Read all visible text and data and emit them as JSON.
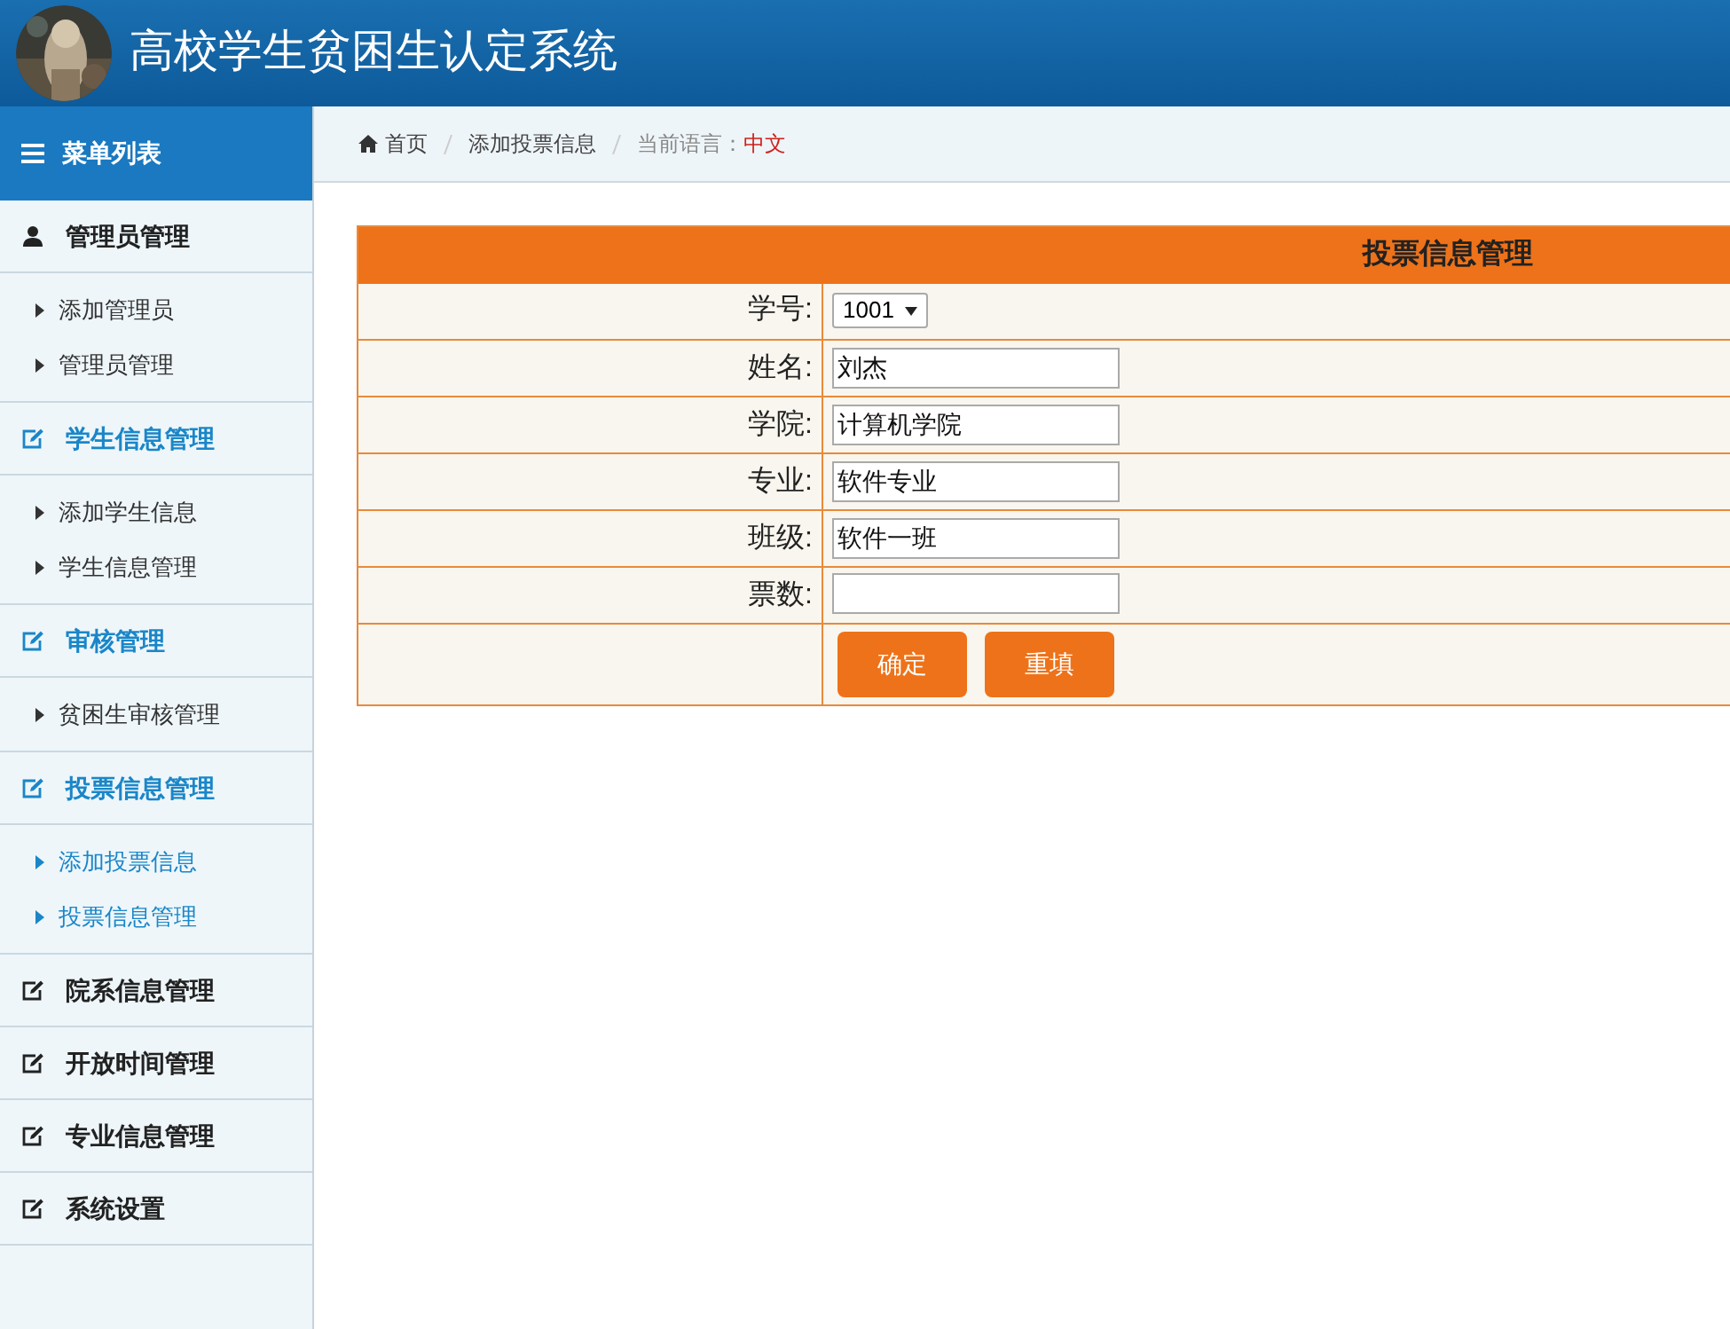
{
  "header": {
    "title": "高校学生贫困生认定系统"
  },
  "sidebar": {
    "title": "菜单列表",
    "groups": [
      {
        "label": "管理员管理",
        "highlighted": false,
        "children": [
          {
            "label": "添加管理员",
            "active": false
          },
          {
            "label": "管理员管理",
            "active": false
          }
        ]
      },
      {
        "label": "学生信息管理",
        "highlighted": true,
        "children": [
          {
            "label": "添加学生信息",
            "active": false
          },
          {
            "label": "学生信息管理",
            "active": false
          }
        ]
      },
      {
        "label": "审核管理",
        "highlighted": true,
        "children": [
          {
            "label": "贫困生审核管理",
            "active": false
          }
        ]
      },
      {
        "label": "投票信息管理",
        "highlighted": true,
        "children": [
          {
            "label": "添加投票信息",
            "active": true
          },
          {
            "label": "投票信息管理",
            "active": true
          }
        ]
      },
      {
        "label": "院系信息管理",
        "highlighted": false
      },
      {
        "label": "开放时间管理",
        "highlighted": false
      },
      {
        "label": "专业信息管理",
        "highlighted": false
      },
      {
        "label": "系统设置",
        "highlighted": false
      }
    ]
  },
  "breadcrumb": {
    "items": [
      "首页",
      "添加投票信息"
    ],
    "language_label": "当前语言：",
    "language": "中文"
  },
  "form": {
    "title": "投票信息管理",
    "fields": [
      {
        "label": "学号:",
        "kind": "select",
        "value": "1001"
      },
      {
        "label": "姓名:",
        "kind": "text",
        "value": "刘杰"
      },
      {
        "label": "学院:",
        "kind": "text",
        "value": "计算机学院"
      },
      {
        "label": "专业:",
        "kind": "text",
        "value": "软件专业"
      },
      {
        "label": "班级:",
        "kind": "text",
        "value": "软件一班"
      },
      {
        "label": "票数:",
        "kind": "text"
      }
    ],
    "buttons": [
      "确定",
      "重填"
    ]
  }
}
